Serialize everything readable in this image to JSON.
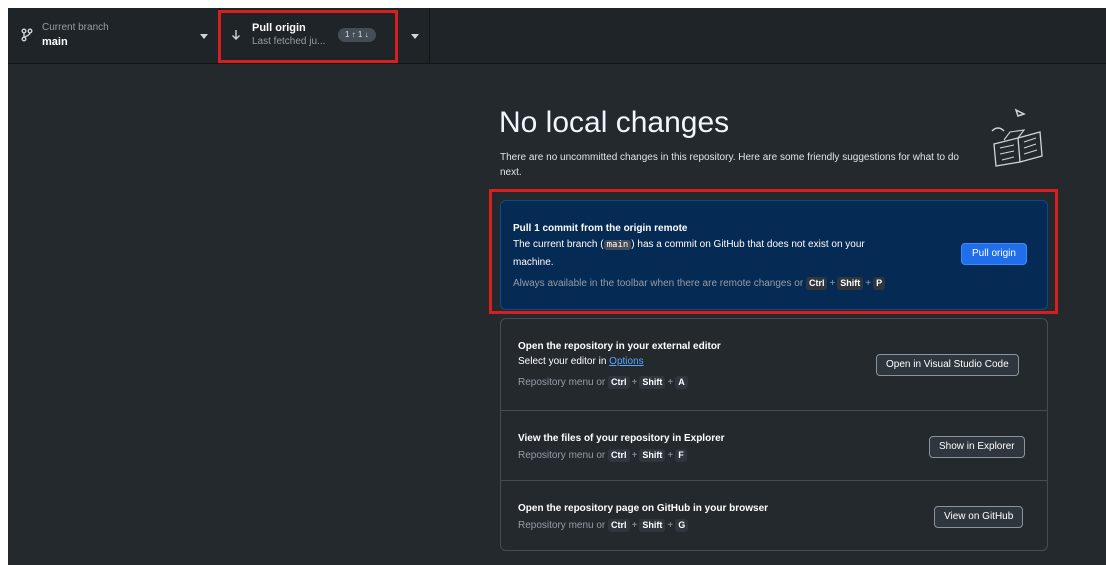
{
  "toolbar": {
    "branch": {
      "caption": "Current branch",
      "name": "main"
    },
    "pull": {
      "title": "Pull origin",
      "caption": "Last fetched ju...",
      "ahead_behind": "1 ↑ 1 ↓"
    }
  },
  "main": {
    "title": "No local changes",
    "subtitle": "There are no uncommitted changes in this repository. Here are some friendly suggestions for what to do next.",
    "pull_card": {
      "title": "Pull 1 commit from the origin remote",
      "text_before": "The current branch (",
      "branch_code": "main",
      "text_after": ") has a commit on GitHub that does not exist on your",
      "text_line2": "machine.",
      "shortcut_prefix": "Always available in the toolbar when there are remote changes or",
      "keys": [
        "Ctrl",
        "Shift",
        "P"
      ],
      "button": "Pull origin"
    },
    "actions": [
      {
        "title": "Open the repository in your external editor",
        "text_prefix": "Select your editor in ",
        "link": "Options",
        "shortcut_prefix": "Repository menu or",
        "keys": [
          "Ctrl",
          "Shift",
          "A"
        ],
        "button": "Open in Visual Studio Code"
      },
      {
        "title": "View the files of your repository in Explorer",
        "shortcut_prefix": "Repository menu or",
        "keys": [
          "Ctrl",
          "Shift",
          "F"
        ],
        "button": "Show in Explorer"
      },
      {
        "title": "Open the repository page on GitHub in your browser",
        "shortcut_prefix": "Repository menu or",
        "keys": [
          "Ctrl",
          "Shift",
          "G"
        ],
        "button": "View on GitHub"
      }
    ]
  },
  "colors": {
    "background": "#24292e",
    "toolbar": "#1f2428",
    "pull_card_bg": "#052a54",
    "primary_button": "#1f6feb",
    "link": "#58a6ff",
    "highlight": "#d71f1f"
  }
}
